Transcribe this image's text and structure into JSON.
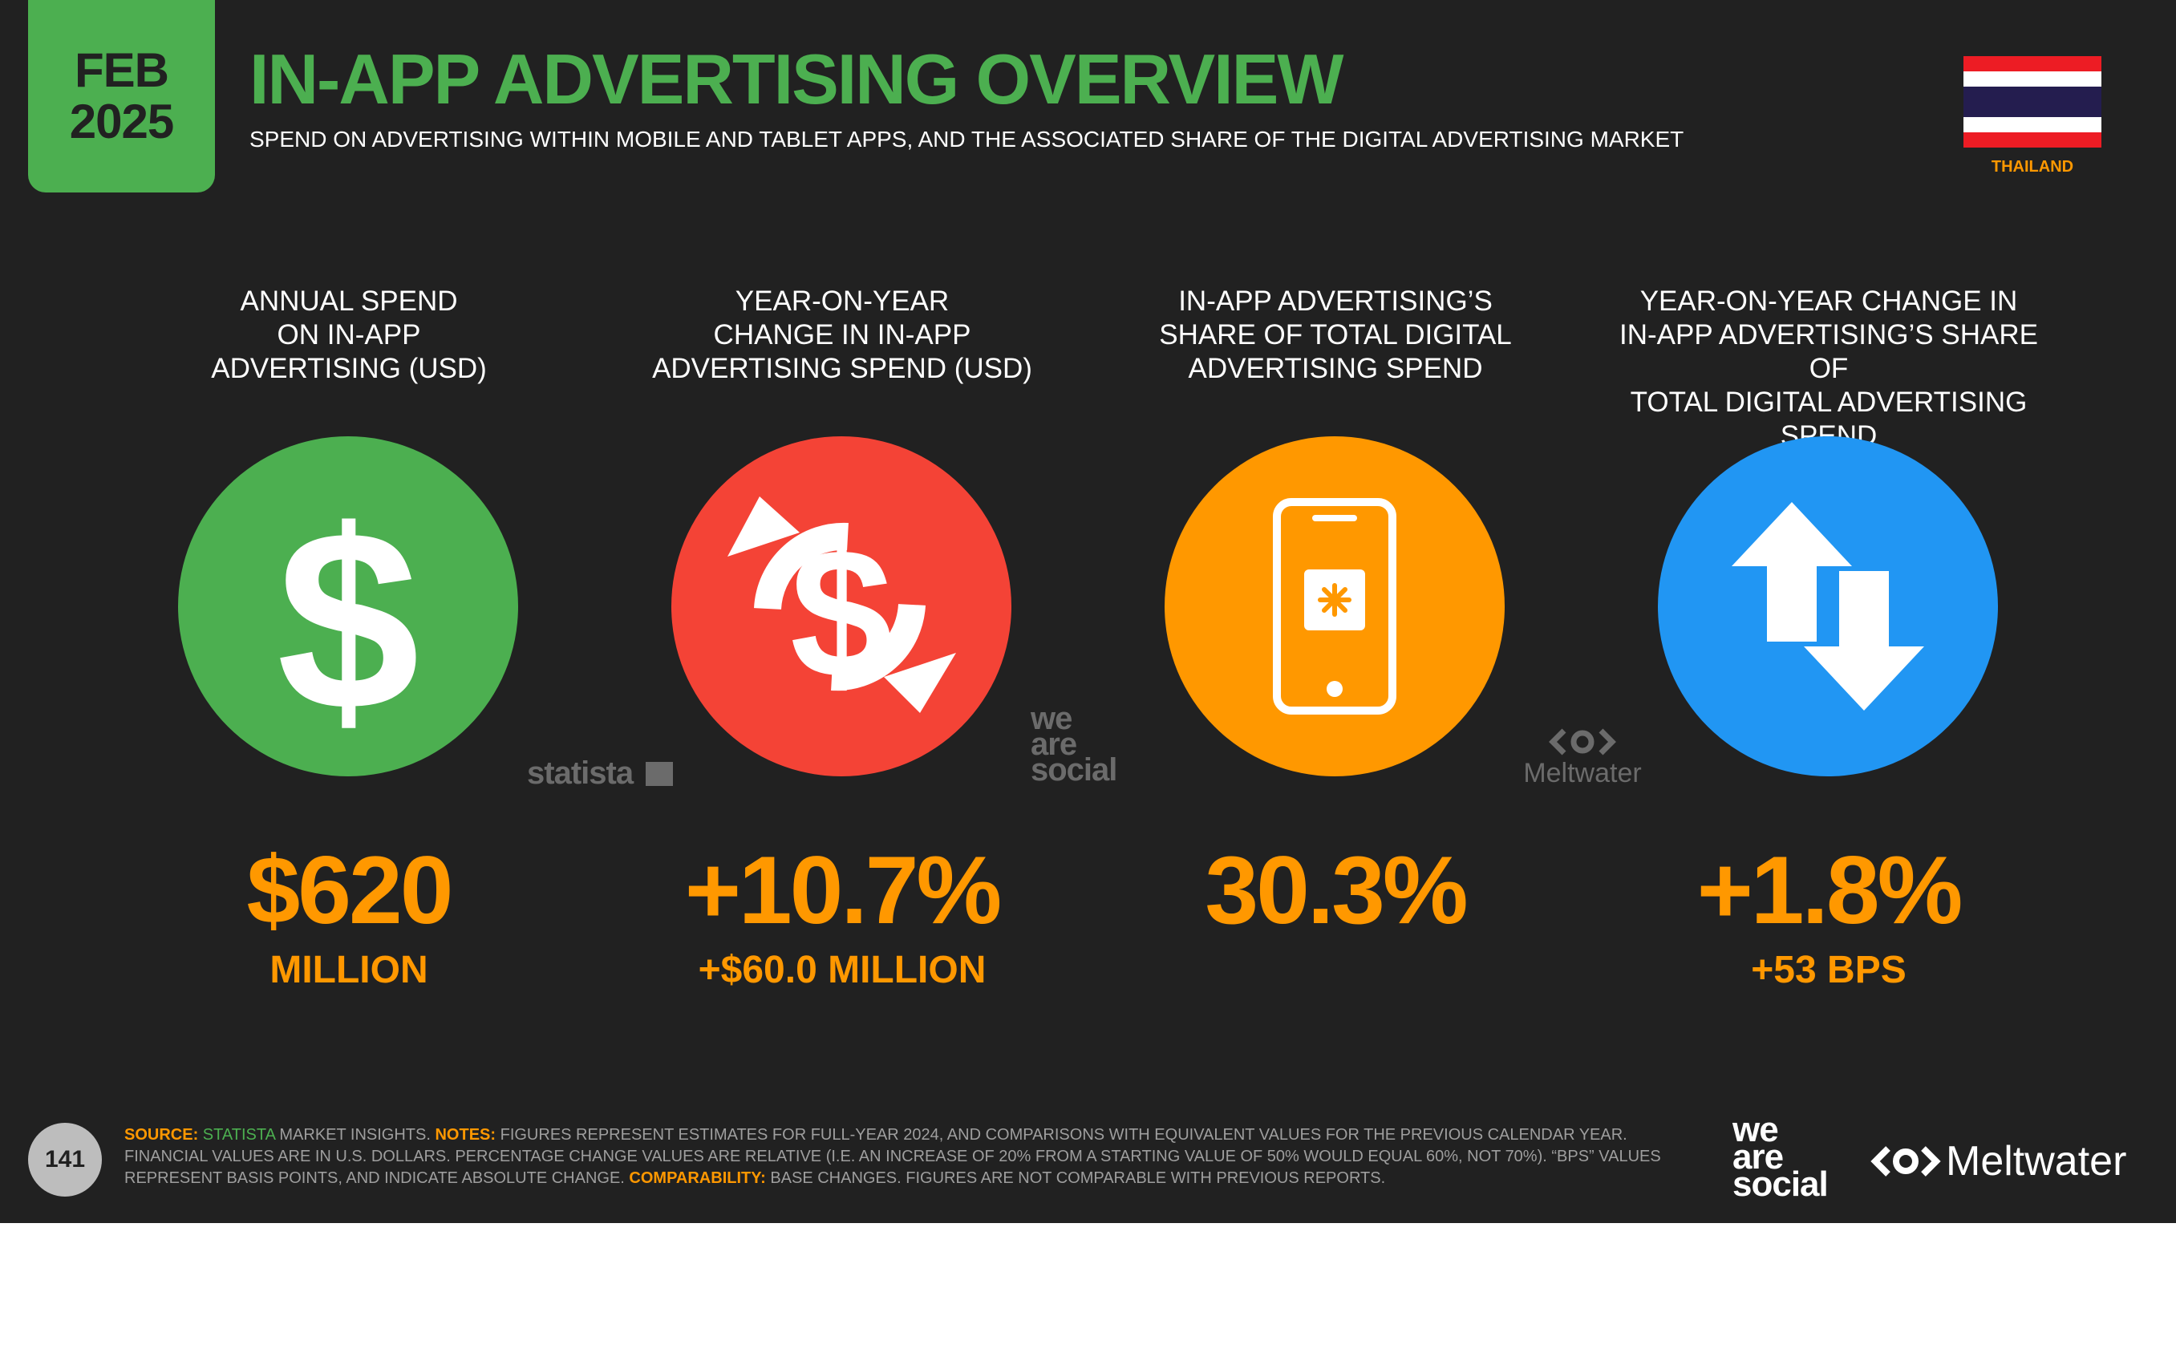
{
  "header": {
    "date_month": "FEB",
    "date_year": "2025",
    "title": "IN-APP ADVERTISING OVERVIEW",
    "subtitle": "SPEND ON ADVERTISING WITHIN MOBILE AND TABLET APPS, AND THE ASSOCIATED SHARE OF THE DIGITAL ADVERTISING MARKET",
    "country": "THAILAND"
  },
  "colors": {
    "background": "#212121",
    "accent_green": "#4CAF50",
    "accent_orange": "#FF9800",
    "circle_red": "#F44336",
    "circle_orange": "#FF9800",
    "circle_blue": "#2196F3"
  },
  "stats": [
    {
      "heading": [
        "ANNUAL SPEND",
        "ON IN-APP",
        "ADVERTISING (USD)"
      ],
      "icon": "dollar-icon",
      "value": "$620",
      "sub": "MILLION"
    },
    {
      "heading": [
        "YEAR-ON-YEAR",
        "CHANGE IN IN-APP",
        "ADVERTISING SPEND (USD)"
      ],
      "icon": "dollar-cycle-icon",
      "value": "+10.7%",
      "sub": "+$60.0 MILLION"
    },
    {
      "heading": [
        "IN-APP ADVERTISING’S",
        "SHARE OF TOTAL DIGITAL",
        "ADVERTISING SPEND"
      ],
      "icon": "smartphone-icon",
      "value": "30.3%",
      "sub": ""
    },
    {
      "heading": [
        "YEAR-ON-YEAR CHANGE IN",
        "IN-APP ADVERTISING’S SHARE OF",
        "TOTAL DIGITAL ADVERTISING SPEND"
      ],
      "icon": "up-down-arrows-icon",
      "value": "+1.8%",
      "sub": "+53 BPS"
    }
  ],
  "watermarks": {
    "statista": "statista",
    "wearesocial": [
      "we",
      "are",
      "social"
    ],
    "meltwater": "Meltwater"
  },
  "footer": {
    "page_number": "141",
    "source_label": "SOURCE:",
    "source_name": "STATISTA",
    "source_rest": " MARKET INSIGHTS. ",
    "notes_label": "NOTES:",
    "notes_text": " FIGURES REPRESENT ESTIMATES FOR FULL-YEAR 2024, AND COMPARISONS WITH EQUIVALENT VALUES FOR THE PREVIOUS CALENDAR YEAR. FINANCIAL VALUES ARE IN U.S. DOLLARS. PERCENTAGE CHANGE VALUES ARE RELATIVE (I.E. AN INCREASE OF 20% FROM A STARTING VALUE OF 50% WOULD EQUAL 60%, NOT 70%). “BPS” VALUES REPRESENT BASIS POINTS, AND INDICATE ABSOLUTE CHANGE. ",
    "comparability_label": "COMPARABILITY:",
    "comparability_text": " BASE CHANGES. FIGURES ARE NOT COMPARABLE WITH PREVIOUS REPORTS."
  },
  "brands": {
    "wearesocial": [
      "we",
      "are",
      "social"
    ],
    "meltwater": "Meltwater"
  }
}
